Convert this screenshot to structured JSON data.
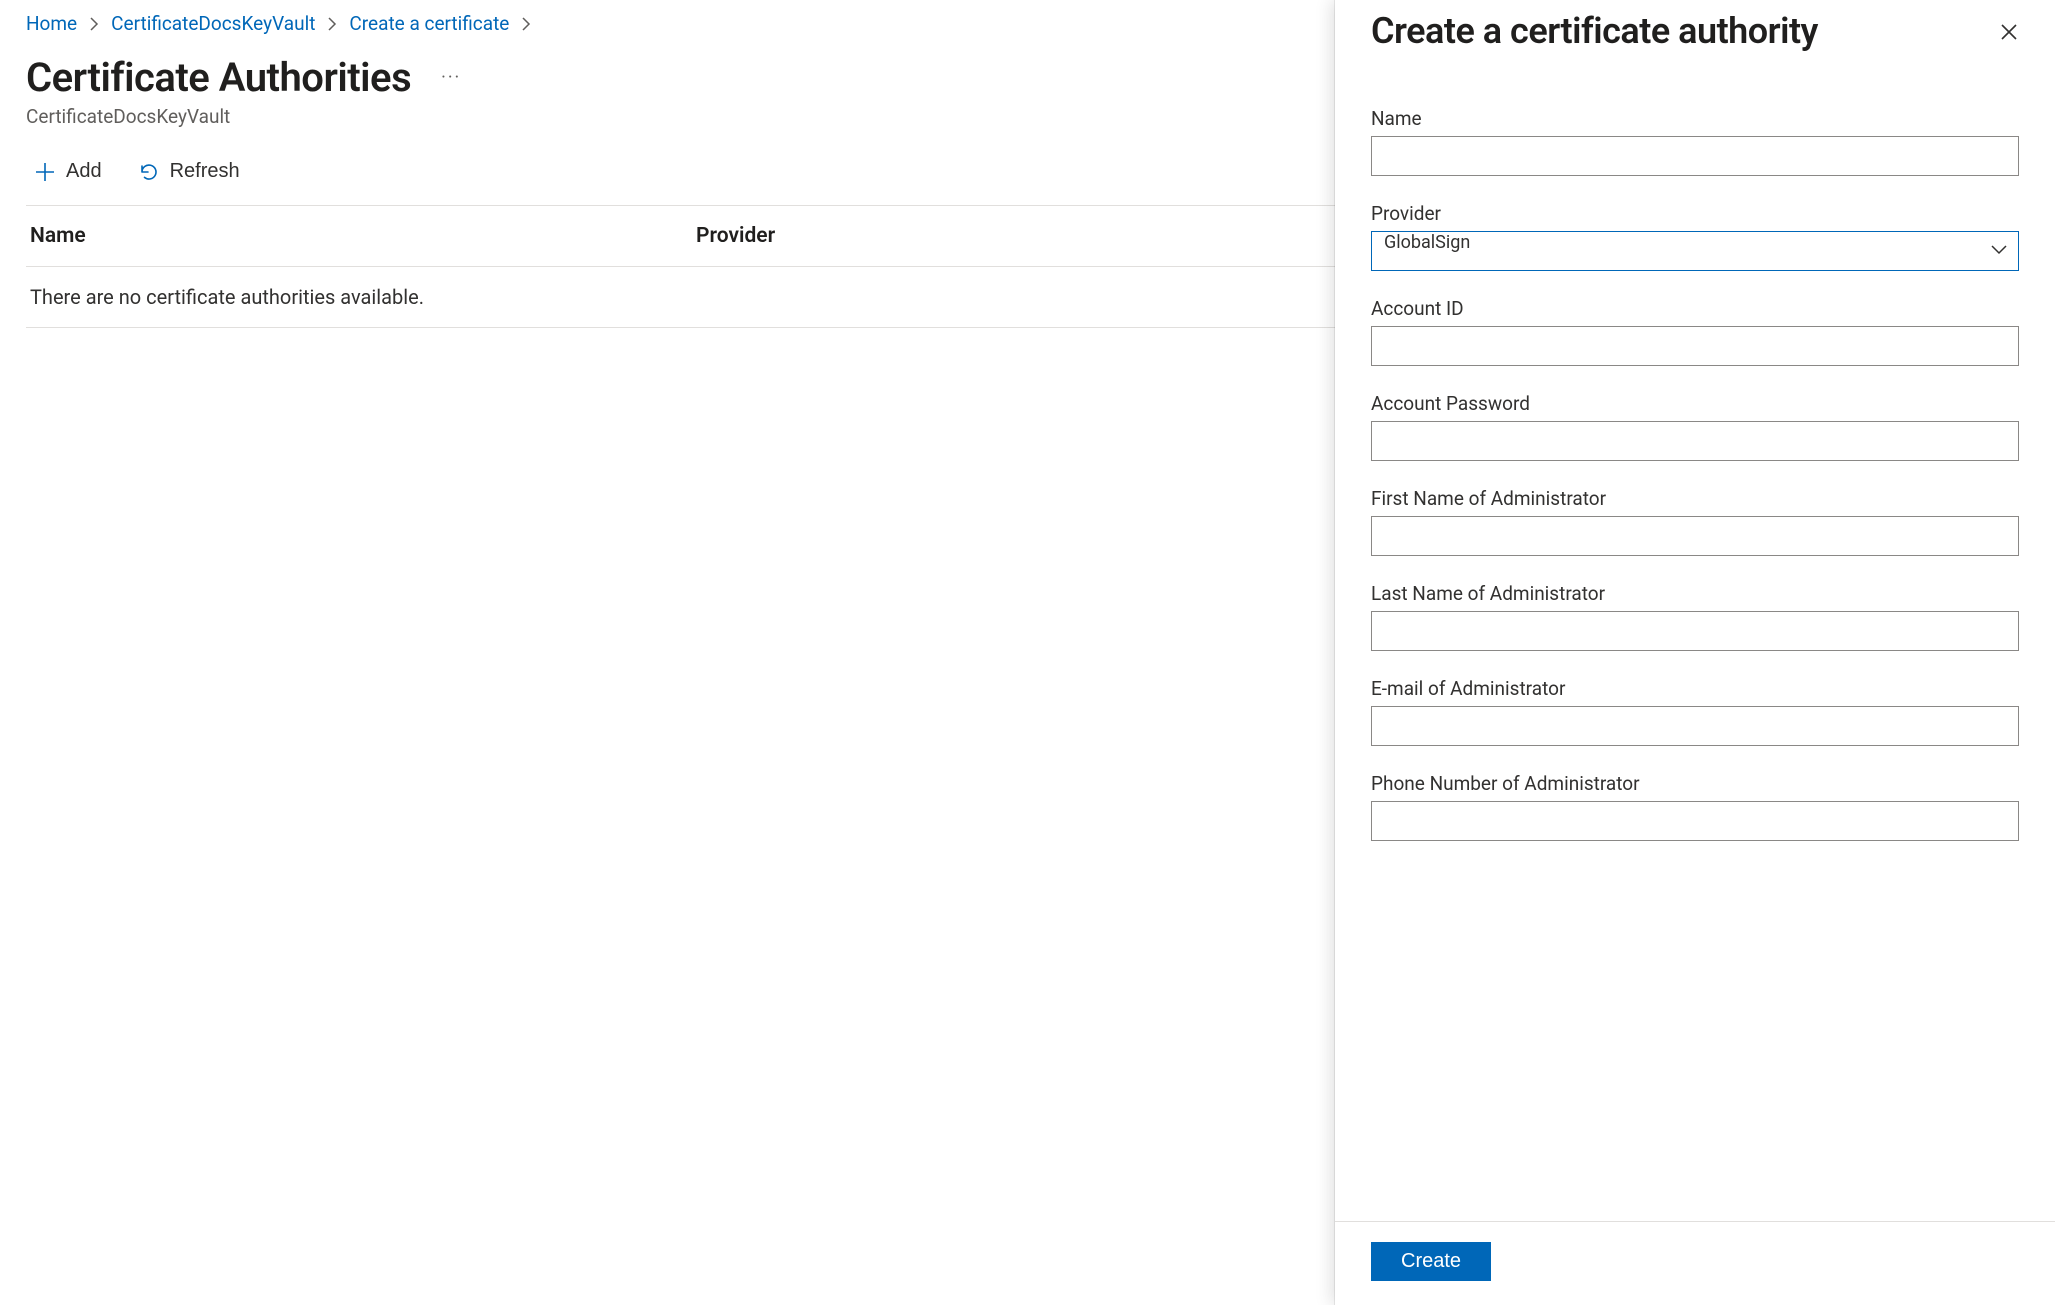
{
  "breadcrumb": {
    "items": [
      {
        "label": "Home"
      },
      {
        "label": "CertificateDocsKeyVault"
      },
      {
        "label": "Create a certificate"
      }
    ]
  },
  "page": {
    "title": "Certificate Authorities",
    "subtitle": "CertificateDocsKeyVault"
  },
  "toolbar": {
    "add_label": "Add",
    "refresh_label": "Refresh"
  },
  "table": {
    "columns": {
      "name": "Name",
      "provider": "Provider"
    },
    "empty_message": "There are no certificate authorities available."
  },
  "panel": {
    "title": "Create a certificate authority",
    "fields": {
      "name_label": "Name",
      "name_value": "",
      "provider_label": "Provider",
      "provider_value": "GlobalSign",
      "account_id_label": "Account ID",
      "account_id_value": "",
      "account_password_label": "Account Password",
      "account_password_value": "",
      "admin_first_label": "First Name of Administrator",
      "admin_first_value": "",
      "admin_last_label": "Last Name of Administrator",
      "admin_last_value": "",
      "admin_email_label": "E-mail of Administrator",
      "admin_email_value": "",
      "admin_phone_label": "Phone Number of Administrator",
      "admin_phone_value": ""
    },
    "submit_label": "Create"
  }
}
